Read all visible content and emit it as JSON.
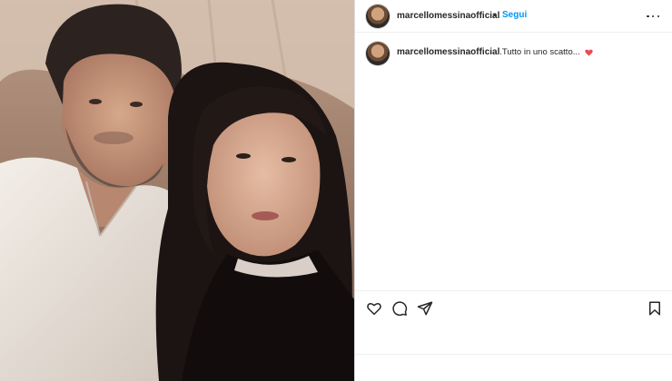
{
  "post": {
    "username": "marcellomessinaofficial",
    "separator": "•",
    "follow_label": "Segui",
    "caption": "...Tutto in uno scatto...",
    "caption_emoji": "red-heart",
    "photo_description": "selfie"
  },
  "icons": {
    "more": "more-options-icon",
    "like": "heart-outline-icon",
    "comment": "comment-bubble-icon",
    "share": "paper-plane-icon",
    "save": "bookmark-icon"
  },
  "colors": {
    "follow_blue": "#0095f6",
    "heart_red": "#ed4956",
    "text": "#262626"
  }
}
